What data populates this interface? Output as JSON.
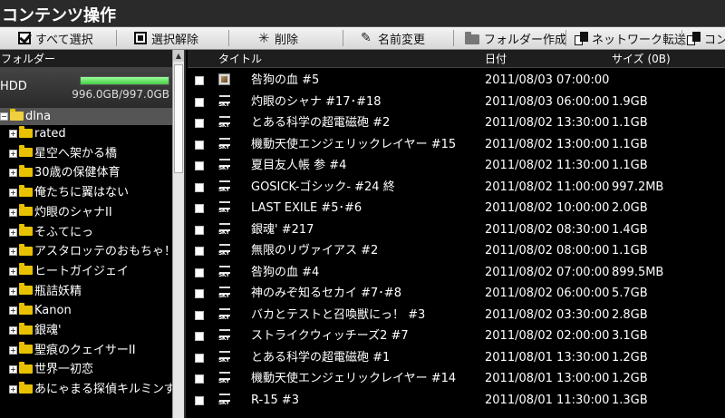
{
  "header": {
    "title": "コンテンツ操作"
  },
  "toolbar": {
    "select_all": "すべて選択",
    "deselect": "選択解除",
    "delete": "削除",
    "rename": "名前変更",
    "new_folder": "フォルダー作成",
    "network_transfer": "ネットワーク転送",
    "overflow": "コン"
  },
  "sidebar": {
    "header": "フォルダー",
    "drive": {
      "label": "HDD",
      "capacity": "996.0GB/997.0GB",
      "usage_fraction": 0.999
    },
    "root": "dlna",
    "folders": [
      "rated",
      "星空へ架かる橋",
      "30歳の保健体育",
      "俺たちに翼はない",
      "灼眼のシャナII",
      "そふてにっ",
      "アスタロッテのおもちゃ！",
      "ヒートガイジェイ",
      "瓶詰妖精",
      "Kanon",
      "銀魂'",
      "聖痕のクェイサーII",
      "世界一初恋",
      "あにゃまる探偵キルミンずぅ"
    ]
  },
  "list": {
    "columns": {
      "title": "タイトル",
      "date": "日付",
      "size": "サイズ (0B)"
    },
    "rows": [
      {
        "icon": "tv",
        "title": "咎狗の血 #5",
        "date": "2011/08/03 07:00:00",
        "size": ""
      },
      {
        "icon": "sky",
        "title": "灼眼のシャナ #17･#18",
        "date": "2011/08/03 06:00:00",
        "size": "1.9GB"
      },
      {
        "icon": "sky",
        "title": "とある科学の超電磁砲 #2",
        "date": "2011/08/02 13:30:00",
        "size": "1.1GB"
      },
      {
        "icon": "sky",
        "title": "機動天使エンジェリックレイヤー #15",
        "date": "2011/08/02 13:00:00",
        "size": "1.1GB"
      },
      {
        "icon": "sky",
        "title": "夏目友人帳 参 #4",
        "date": "2011/08/02 11:30:00",
        "size": "1.1GB"
      },
      {
        "icon": "sky",
        "title": "GOSICK-ゴシック- #24 終",
        "date": "2011/08/02 11:00:00",
        "size": "997.2MB"
      },
      {
        "icon": "sky",
        "title": "LAST EXILE #5･#6",
        "date": "2011/08/02 10:00:00",
        "size": "2.0GB"
      },
      {
        "icon": "sky",
        "title": "銀魂' #217",
        "date": "2011/08/02 08:30:00",
        "size": "1.4GB"
      },
      {
        "icon": "sky",
        "title": "無限のリヴァイアス #2",
        "date": "2011/08/02 08:00:00",
        "size": "1.1GB"
      },
      {
        "icon": "sky",
        "title": "咎狗の血 #4",
        "date": "2011/08/02 07:00:00",
        "size": "899.5MB"
      },
      {
        "icon": "sky",
        "title": "神のみぞ知るセカイ #7･#8",
        "date": "2011/08/02 06:00:00",
        "size": "5.7GB"
      },
      {
        "icon": "sky",
        "title": "バカとテストと召喚獣にっ！ #3",
        "date": "2011/08/02 03:30:00",
        "size": "2.8GB"
      },
      {
        "icon": "sky",
        "title": "ストライクウィッチーズ2 #7",
        "date": "2011/08/02 02:00:00",
        "size": "3.1GB"
      },
      {
        "icon": "sky",
        "title": "とある科学の超電磁砲 #1",
        "date": "2011/08/01 13:30:00",
        "size": "1.2GB"
      },
      {
        "icon": "sky",
        "title": "機動天使エンジェリックレイヤー #14",
        "date": "2011/08/01 13:00:00",
        "size": "1.2GB"
      },
      {
        "icon": "sky",
        "title": "R-15 #3",
        "date": "2011/08/01 11:30:00",
        "size": "1.3GB"
      }
    ]
  }
}
